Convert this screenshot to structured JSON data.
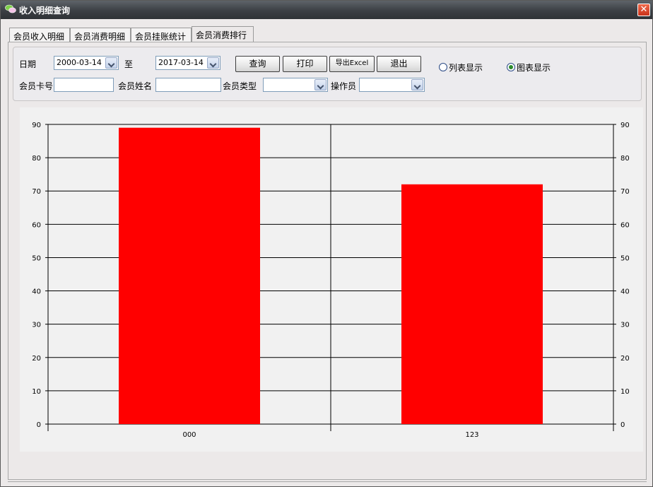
{
  "window": {
    "title": "收入明细查询",
    "close_glyph": "✕"
  },
  "tabs": [
    {
      "label": "会员收入明细",
      "active": false
    },
    {
      "label": "会员消费明细",
      "active": false
    },
    {
      "label": "会员挂账统计",
      "active": false
    },
    {
      "label": "会员消费排行",
      "active": true
    }
  ],
  "filters": {
    "date_label": "日期",
    "date_from": "2000-03-14",
    "to_label": "至",
    "date_to": "2017-03-14",
    "card_label": "会员卡号",
    "card_value": "",
    "name_label": "会员姓名",
    "name_value": "",
    "type_label": "会员类型",
    "type_value": "",
    "operator_label": "操作员",
    "operator_value": ""
  },
  "buttons": {
    "query": "查询",
    "print": "打印",
    "export": "导出Excel",
    "exit": "退出"
  },
  "view_mode": {
    "list_label": "列表显示",
    "chart_label": "图表显示",
    "selected": "chart"
  },
  "chart_data": {
    "type": "bar",
    "categories": [
      "000",
      "123"
    ],
    "values": [
      89,
      72
    ],
    "ylim": [
      0,
      90
    ],
    "yticks": [
      0,
      10,
      20,
      30,
      40,
      50,
      60,
      70,
      80,
      90
    ],
    "bar_color": "#ff0000",
    "grid": true,
    "title": "",
    "xlabel": "",
    "ylabel": ""
  },
  "colors": {
    "bar": "#ff0000",
    "titlebar": "#3b3f44",
    "close": "#d8401f"
  }
}
